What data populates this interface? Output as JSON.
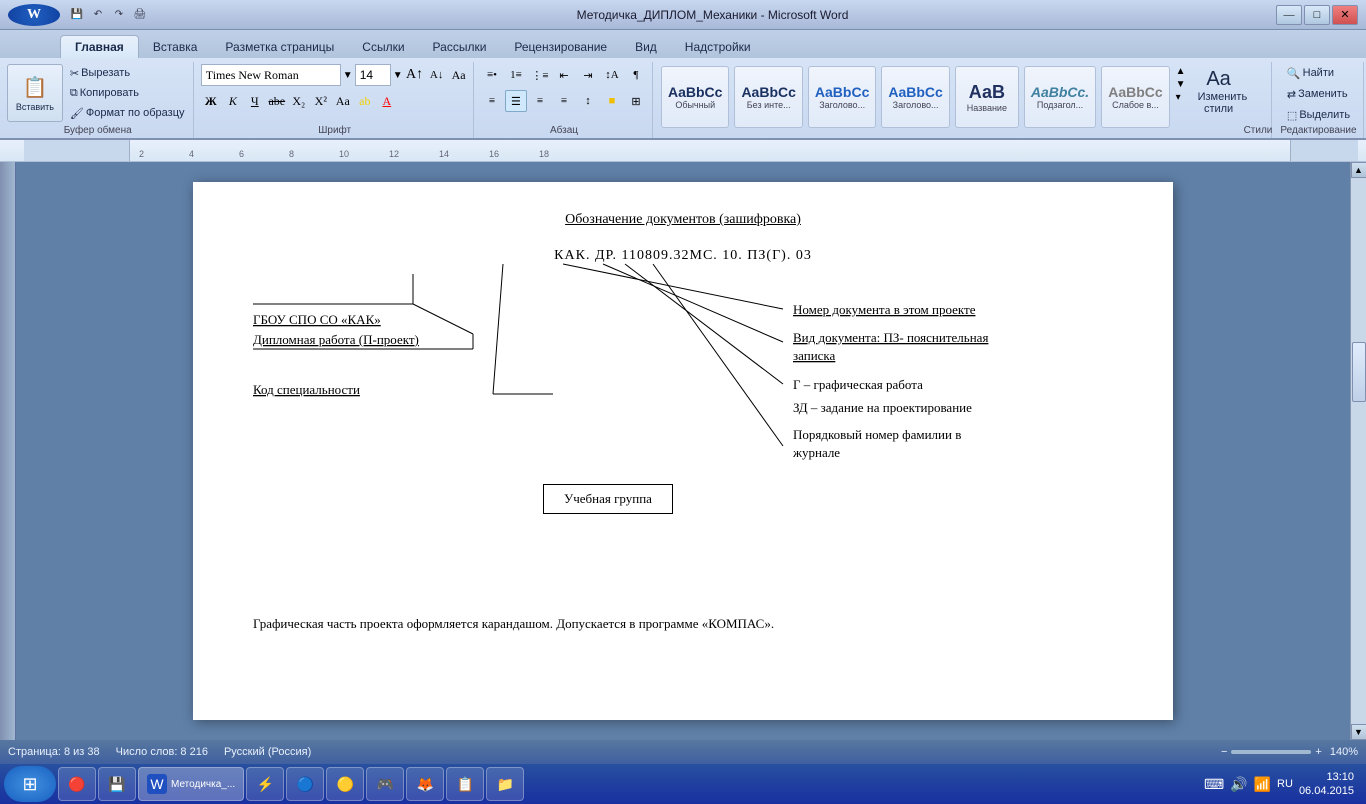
{
  "titlebar": {
    "title": "Методичка_ДИПЛОМ_Механики - Microsoft Word",
    "min_label": "—",
    "max_label": "□",
    "close_label": "✕"
  },
  "ribbon": {
    "tabs": [
      "Главная",
      "Вставка",
      "Разметка страницы",
      "Ссылки",
      "Рассылки",
      "Рецензирование",
      "Вид",
      "Надстройки"
    ],
    "active_tab": "Главная",
    "font_name": "Times New Roman",
    "font_size": "14",
    "paste_label": "Вставить",
    "clipboard_group": "Буфер обмена",
    "font_group": "Шрифт",
    "para_group": "Абзац",
    "styles_group": "Стили",
    "edit_group": "Редактирование",
    "cut_label": "Вырезать",
    "copy_label": "Копировать",
    "format_label": "Формат по образцу",
    "find_label": "Найти",
    "replace_label": "Заменить",
    "select_label": "Выделить",
    "change_styles_label": "Изменить стили",
    "styles": [
      {
        "label": "Обычный",
        "tag": "AaBbCc"
      },
      {
        "label": "Без инте...",
        "tag": "AaBbCc"
      },
      {
        "label": "Заголово...",
        "tag": "AaBbCc"
      },
      {
        "label": "Заголово...",
        "tag": "AaBbCc"
      },
      {
        "label": "Название",
        "tag": "AaBbCc"
      },
      {
        "label": "Подзагол...",
        "tag": "AaBbCc"
      },
      {
        "label": "Слабое в...",
        "tag": "AaBbCc"
      }
    ]
  },
  "document": {
    "title": "Обозначение документов (зашифровка)",
    "code": "КАК. ДР. 110809.32МС. 10. ПЗ(Г). 03",
    "left_labels": [
      "ГБОУ СПО СО «КАК»",
      "Дипломная работа (П-проект)",
      "",
      "Код специальности"
    ],
    "right_labels": [
      "Номер документа в этом проекте",
      "Вид документа: ПЗ- пояснительная",
      "записка",
      "Г – графическая работа",
      "ЗД – задание на проектирование",
      "Порядковый номер фамилии в",
      "журнале"
    ],
    "group_box_label": "Учебная группа",
    "footer_text": "Графическая часть проекта оформляется карандашом. Допускается в программе «КОМПАС»."
  },
  "statusbar": {
    "page_info": "Страница: 8 из 38",
    "word_count": "Число слов: 8 216",
    "language": "Русский (Россия)",
    "zoom_level": "140%"
  },
  "taskbar": {
    "time": "13:10",
    "date": "06.04.2015",
    "lang": "RU",
    "apps": [
      "⊞",
      "🔴",
      "💾",
      "W",
      "⚡",
      "🔵",
      "🟡",
      "🎮",
      "🦊",
      "📋",
      "📁"
    ]
  }
}
